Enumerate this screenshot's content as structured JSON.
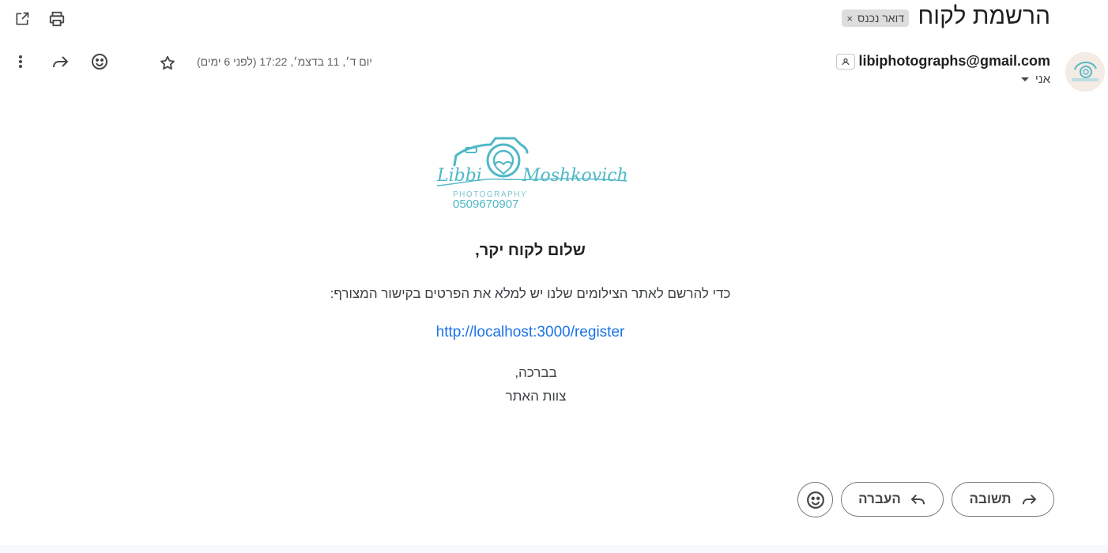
{
  "header": {
    "subject": "הרשמת לקוח",
    "label": "דואר נכנס",
    "label_remove": "×"
  },
  "toolbar_top": {
    "open_new_window_icon": "open-in-new-icon",
    "print_icon": "print-icon"
  },
  "message": {
    "sender_email": "libiphotographs@gmail.com",
    "recipient": "אני",
    "date": "יום ד׳, 11 בדצמ׳, 17:22 (לפני 6 ימים)",
    "icons": [
      "more-vert-icon",
      "reply-icon",
      "emoji-icon",
      "star-icon"
    ]
  },
  "logo": {
    "name_script": "Libbi Moshkovich",
    "tagline": "PHOTOGRAPHY",
    "phone": "0509670907",
    "color": "#4fb8c6"
  },
  "body": {
    "greeting": "שלום לקוח יקר,",
    "instruction": "כדי להרשם לאתר הצילומים שלנו יש למלא את הפרטים בקישור המצורף:",
    "link": "http://localhost:3000/register",
    "sign_line_1": "בברכה,",
    "sign_line_2": "צוות האתר"
  },
  "actions": {
    "reply_label": "תשובה",
    "forward_label": "העברה"
  },
  "colors": {
    "link": "#1a73e8",
    "chip_bg": "#dddddd",
    "text": "#1f1f1f"
  }
}
